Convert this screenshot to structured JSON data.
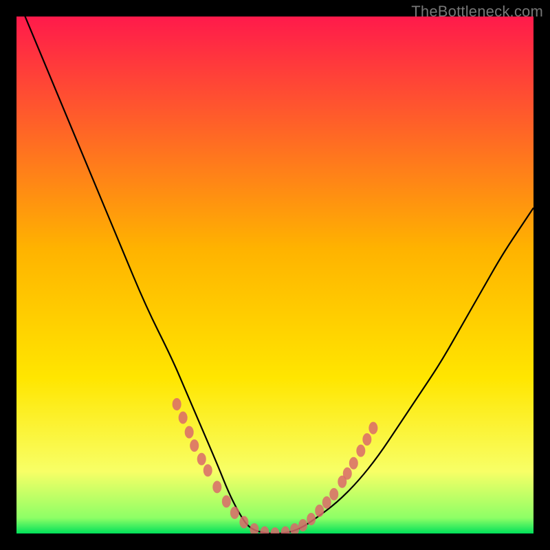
{
  "watermark": "TheBottleneck.com",
  "chart_data": {
    "type": "line",
    "title": "",
    "xlabel": "",
    "ylabel": "",
    "xlim": [
      0,
      100
    ],
    "ylim": [
      0,
      100
    ],
    "background_gradient": {
      "stops": [
        {
          "offset": 0.0,
          "color": "#ff1a4b"
        },
        {
          "offset": 0.45,
          "color": "#ffb300"
        },
        {
          "offset": 0.7,
          "color": "#ffe600"
        },
        {
          "offset": 0.88,
          "color": "#f8ff66"
        },
        {
          "offset": 0.97,
          "color": "#8dff66"
        },
        {
          "offset": 1.0,
          "color": "#00e05a"
        }
      ]
    },
    "series": [
      {
        "name": "bottleneck-curve",
        "color": "#000000",
        "x": [
          0,
          5,
          10,
          15,
          20,
          25,
          30,
          33,
          36,
          39,
          41,
          43,
          45,
          48,
          52,
          55,
          58,
          62,
          66,
          70,
          74,
          78,
          82,
          86,
          90,
          94,
          98,
          100
        ],
        "y": [
          104,
          92,
          80,
          68,
          56,
          44,
          34,
          27,
          20,
          13,
          8,
          4,
          1,
          0,
          0,
          1,
          3,
          6,
          10,
          15,
          21,
          27,
          33,
          40,
          47,
          54,
          60,
          63
        ]
      }
    ],
    "marker_clusters": [
      {
        "name": "left-arm-markers",
        "color": "#d96a6a",
        "points": [
          {
            "x": 31.0,
            "y": 25.0
          },
          {
            "x": 32.2,
            "y": 22.4
          },
          {
            "x": 33.4,
            "y": 19.6
          },
          {
            "x": 34.4,
            "y": 17.0
          },
          {
            "x": 35.8,
            "y": 14.4
          },
          {
            "x": 37.0,
            "y": 12.2
          },
          {
            "x": 38.8,
            "y": 9.0
          },
          {
            "x": 40.6,
            "y": 6.2
          },
          {
            "x": 42.2,
            "y": 4.0
          },
          {
            "x": 44.0,
            "y": 2.2
          }
        ]
      },
      {
        "name": "valley-markers",
        "color": "#d96a6a",
        "points": [
          {
            "x": 46.0,
            "y": 0.8
          },
          {
            "x": 48.0,
            "y": 0.2
          },
          {
            "x": 50.0,
            "y": 0.0
          },
          {
            "x": 52.0,
            "y": 0.2
          },
          {
            "x": 53.8,
            "y": 0.8
          },
          {
            "x": 55.4,
            "y": 1.6
          },
          {
            "x": 57.0,
            "y": 2.8
          }
        ]
      },
      {
        "name": "right-arm-markers",
        "color": "#d96a6a",
        "points": [
          {
            "x": 58.6,
            "y": 4.4
          },
          {
            "x": 60.0,
            "y": 6.0
          },
          {
            "x": 61.4,
            "y": 7.6
          },
          {
            "x": 63.0,
            "y": 10.0
          },
          {
            "x": 64.0,
            "y": 11.6
          },
          {
            "x": 65.2,
            "y": 13.6
          },
          {
            "x": 66.6,
            "y": 16.0
          },
          {
            "x": 67.8,
            "y": 18.2
          },
          {
            "x": 69.0,
            "y": 20.4
          }
        ]
      }
    ]
  }
}
